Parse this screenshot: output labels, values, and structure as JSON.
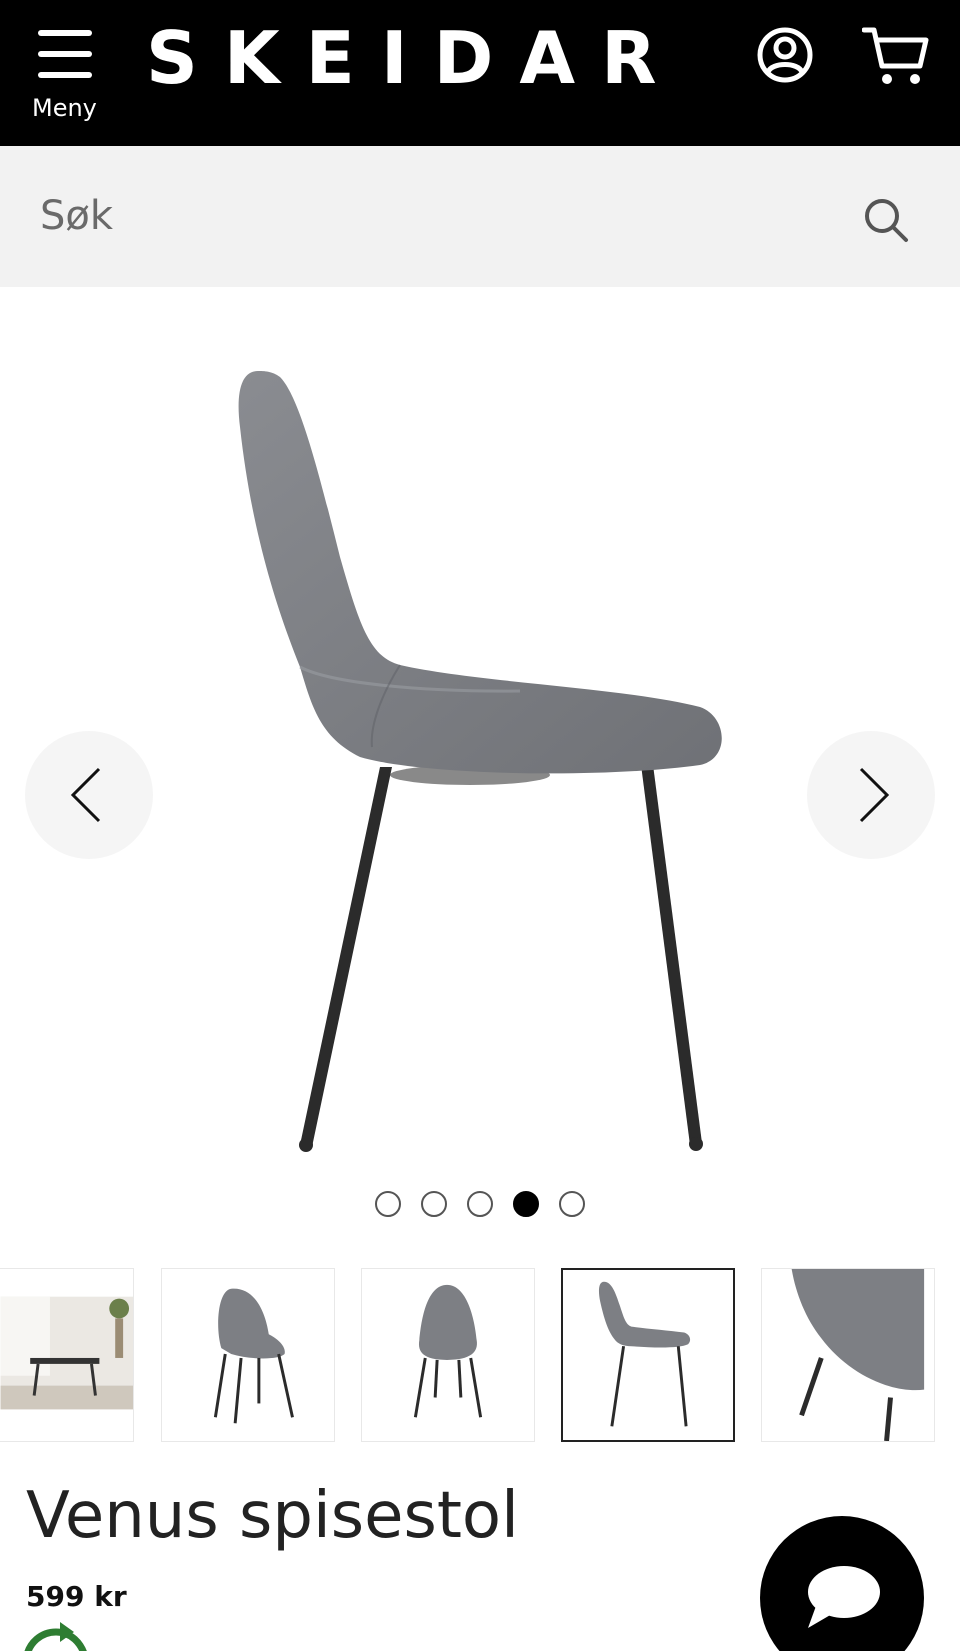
{
  "header": {
    "menu_label": "Meny",
    "logo_text": "SKEIDAR",
    "icons": {
      "menu": "hamburger-icon",
      "user": "user-icon",
      "cart": "cart-icon"
    }
  },
  "search": {
    "placeholder": "Søk",
    "icon": "search-icon"
  },
  "gallery": {
    "slide_count": 5,
    "active_slide": 4,
    "prev_icon": "chevron-left-icon",
    "next_icon": "chevron-right-icon",
    "thumbnails": [
      {
        "kind": "room-scene"
      },
      {
        "kind": "chair-front-angle"
      },
      {
        "kind": "chair-front"
      },
      {
        "kind": "chair-side",
        "selected": true
      },
      {
        "kind": "chair-detail"
      }
    ]
  },
  "product": {
    "title": "Venus spisestol",
    "price": "599 kr"
  },
  "chat": {
    "icon": "chat-bubble-icon"
  },
  "colors": {
    "header_bg": "#000000",
    "search_bg": "#f2f2f2",
    "chair_fabric": "#7d7f84",
    "chair_legs": "#2a2a2a",
    "eco_green": "#2e7d32"
  }
}
